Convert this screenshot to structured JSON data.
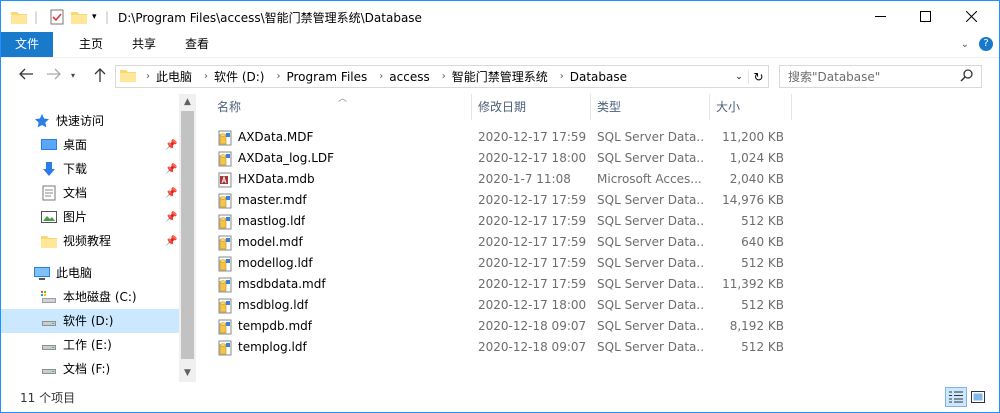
{
  "window": {
    "title": "D:\\Program Files\\access\\智能门禁管理系统\\Database",
    "accent": "#1979ca"
  },
  "ribbon": {
    "tabs": [
      {
        "label": "文件"
      },
      {
        "label": "主页"
      },
      {
        "label": "共享"
      },
      {
        "label": "查看"
      }
    ]
  },
  "address": {
    "crumbs": [
      "此电脑",
      "软件 (D:)",
      "Program Files",
      "access",
      "智能门禁管理系统",
      "Database"
    ]
  },
  "search": {
    "placeholder": "搜索\"Database\""
  },
  "nav": {
    "quick_access": "快速访问",
    "items": [
      {
        "label": "桌面"
      },
      {
        "label": "下载"
      },
      {
        "label": "文档"
      },
      {
        "label": "图片"
      },
      {
        "label": "视频教程"
      }
    ],
    "this_pc": "此电脑",
    "drives": [
      {
        "label": "本地磁盘 (C:)"
      },
      {
        "label": "软件 (D:)"
      },
      {
        "label": "工作 (E:)"
      },
      {
        "label": "文档 (F:)"
      }
    ]
  },
  "columns": {
    "name": "名称",
    "date": "修改日期",
    "type": "类型",
    "size": "大小"
  },
  "files": [
    {
      "name": "AXData.MDF",
      "date": "2020-12-17 17:59",
      "type": "SQL Server Data...",
      "size": "11,200 KB",
      "icon": "sql-db-icon"
    },
    {
      "name": "AXData_log.LDF",
      "date": "2020-12-17 18:00",
      "type": "SQL Server Data...",
      "size": "1,024 KB",
      "icon": "sql-db-icon"
    },
    {
      "name": "HXData.mdb",
      "date": "2020-1-7 11:08",
      "type": "Microsoft Acces...",
      "size": "2,040 KB",
      "icon": "access-db-icon"
    },
    {
      "name": "master.mdf",
      "date": "2020-12-17 17:59",
      "type": "SQL Server Data...",
      "size": "14,976 KB",
      "icon": "sql-db-icon"
    },
    {
      "name": "mastlog.ldf",
      "date": "2020-12-17 17:59",
      "type": "SQL Server Data...",
      "size": "512 KB",
      "icon": "sql-db-icon"
    },
    {
      "name": "model.mdf",
      "date": "2020-12-17 17:59",
      "type": "SQL Server Data...",
      "size": "640 KB",
      "icon": "sql-db-icon"
    },
    {
      "name": "modellog.ldf",
      "date": "2020-12-17 17:59",
      "type": "SQL Server Data...",
      "size": "512 KB",
      "icon": "sql-db-icon"
    },
    {
      "name": "msdbdata.mdf",
      "date": "2020-12-17 17:59",
      "type": "SQL Server Data...",
      "size": "11,392 KB",
      "icon": "sql-db-icon"
    },
    {
      "name": "msdblog.ldf",
      "date": "2020-12-17 18:00",
      "type": "SQL Server Data...",
      "size": "512 KB",
      "icon": "sql-db-icon"
    },
    {
      "name": "tempdb.mdf",
      "date": "2020-12-18 09:07",
      "type": "SQL Server Data...",
      "size": "8,192 KB",
      "icon": "sql-db-icon"
    },
    {
      "name": "templog.ldf",
      "date": "2020-12-18 09:07",
      "type": "SQL Server Data...",
      "size": "512 KB",
      "icon": "sql-db-icon"
    }
  ],
  "status": {
    "count": "11 个项目"
  }
}
